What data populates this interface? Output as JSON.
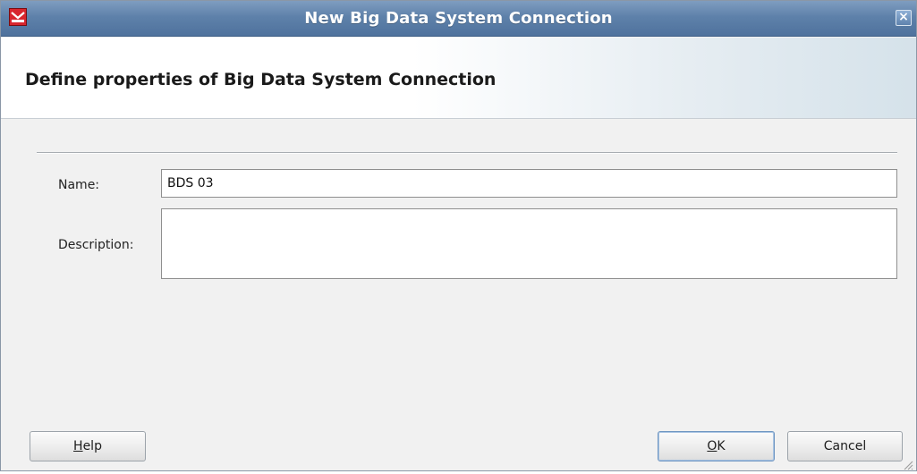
{
  "window": {
    "title": "New Big Data System Connection",
    "close_glyph": "×",
    "icon": "oracle-app-icon",
    "accent_color": "#5e81aa"
  },
  "header": {
    "title": "Define properties of Big Data System Connection"
  },
  "form": {
    "name_label": "Name:",
    "name_value": "BDS 03",
    "description_label": "Description:",
    "description_value": ""
  },
  "buttons": {
    "help": {
      "mnemonic": "H",
      "rest": "elp"
    },
    "ok": {
      "mnemonic": "O",
      "rest": "K"
    },
    "cancel": "Cancel"
  }
}
